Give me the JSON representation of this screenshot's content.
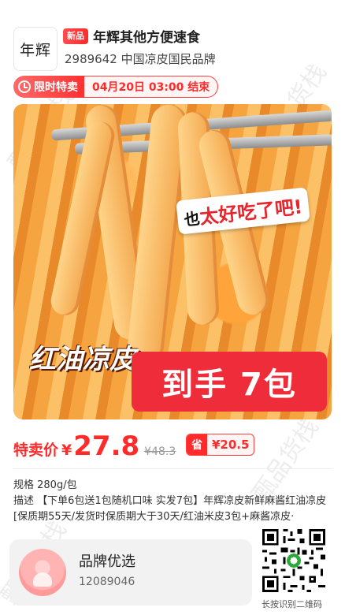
{
  "header": {
    "logo_text": "年辉",
    "new_badge": "新品",
    "title": "年辉其他方便速食",
    "subtitle": "2989642 中国凉皮国民品牌"
  },
  "flash": {
    "label": "限时特卖",
    "end_time": "04月20日 03:00 结束"
  },
  "product_image": {
    "bubble_prefix": "也",
    "bubble_main": "太好吃了吧!",
    "dish_name": "红油凉皮",
    "promo": "到手 7包"
  },
  "price": {
    "label": "特卖价",
    "currency": "¥",
    "value": "27.8",
    "original": "¥48.3",
    "save_icon": "省",
    "save_amount": "¥20.5"
  },
  "specs": {
    "spec_line": "规格 280g/包",
    "description": "描述 【下单6包送1包随机口味 实发7包】年辉凉皮新鲜麻酱红油凉皮[保质期55天/发货时保质期大于30天/红油米皮3包+麻酱凉皮·"
  },
  "brand": {
    "title": "品牌优选",
    "id": "12089046"
  },
  "qr": {
    "caption": "长按识别二维码"
  },
  "watermark": "甄品货栈",
  "colors": {
    "accent": "#ff2a2a",
    "promo_bg": "#ef2d3a"
  }
}
